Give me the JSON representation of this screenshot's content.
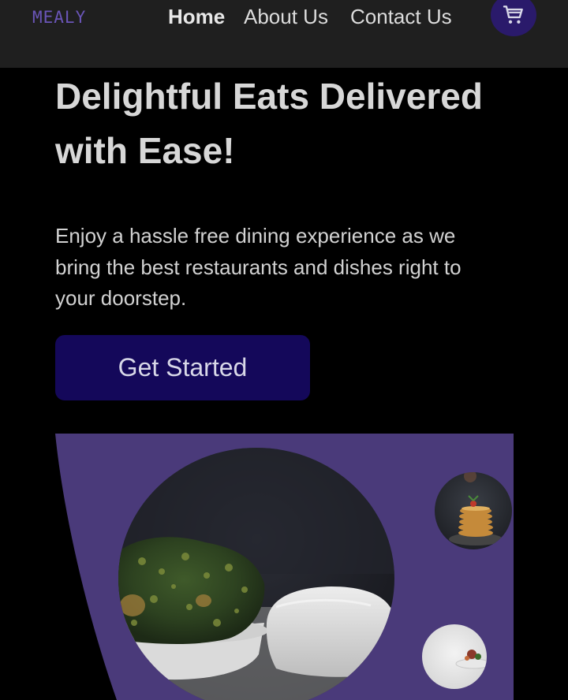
{
  "brand": {
    "logo": "MEALY"
  },
  "nav": {
    "items": [
      {
        "label": "Home",
        "active": true
      },
      {
        "label": "About Us",
        "active": false
      },
      {
        "label": "Contact Us",
        "active": false
      }
    ],
    "cart_icon": "cart-icon"
  },
  "hero": {
    "title_line1": "Delightful Eats Delivered",
    "title_line2": "with Ease!",
    "description_line1": "Enjoy a hassle free dining experience as we",
    "description_line2": "bring the best restaurants and dishes right to",
    "description_line3": "your doorstep.",
    "cta_label": "Get Started"
  },
  "colors": {
    "background": "#000000",
    "navbar": "#1f1f1f",
    "accent_purple": "#4a3a7a",
    "button": "#14085a"
  }
}
